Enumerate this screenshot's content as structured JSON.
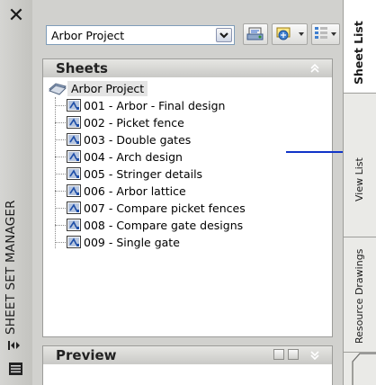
{
  "palette": {
    "title_strip": "#c8c8c5",
    "panel_bg": "#d1d1ce",
    "callout": "#1034c8",
    "sheet_icon_blue": "#1f4fa8"
  },
  "title_strip": {
    "close_icon": "close-icon",
    "title": "SHEET SET MANAGER",
    "autohide_icon": "autohide-icon",
    "properties_icon": "properties-menu-icon"
  },
  "toolbar": {
    "sheet_set_select": {
      "value": "Arbor Project",
      "icon": "chevron-down-icon"
    },
    "buttons": [
      {
        "name": "publish-to-plotter-button",
        "icon": "plotter-icon"
      },
      {
        "name": "publish-button",
        "icon": "publish-icon"
      },
      {
        "name": "sheet-selections-button",
        "icon": "sheet-selections-icon"
      }
    ]
  },
  "sheets_panel": {
    "title": "Sheets",
    "collapse_icon": "collapse-up-icon",
    "root": "Arbor Project",
    "sheets": [
      "001 - Arbor - Final design",
      "002 - Picket fence",
      "003 - Double gates",
      "004 - Arch design",
      "005 - Stringer details",
      "006 - Arbor lattice",
      "007 - Compare picket fences",
      "008 - Compare gate designs",
      "009 - Single gate"
    ]
  },
  "preview_panel": {
    "title": "Preview",
    "expand_icon": "expand-down-icon"
  },
  "tabs": [
    "Sheet List",
    "View List",
    "Resource Drawings"
  ],
  "active_tab": "Sheet List"
}
